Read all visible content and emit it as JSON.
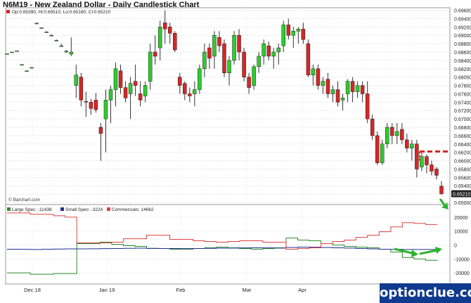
{
  "title": "N6M19 - New Zealand Dollar - Daily Candlestick Chart",
  "colors": {
    "up": "#2ecc2e",
    "down": "#d62626",
    "large_spec": "#2e8b2e",
    "small_spec": "#1f2f8f",
    "commercials": "#e04040",
    "arrow": "#2db32d",
    "level": "#d62626"
  },
  "ohlc_legend": "Op:0.65390, Hi:0.65510, Lo:0.65180, Cl:0.65210",
  "last_price": "0.65210",
  "source": "© Barchart.com",
  "watermark": "optionclue.com",
  "chart_data": [
    {
      "type": "candlestick",
      "title": "N6M19 - New Zealand Dollar - Daily Candlestick Chart",
      "x_ticks": [
        "Dec 18",
        "Jan 19",
        "Feb",
        "Mar",
        "Apr"
      ],
      "y_ticks": [
        "0.69600",
        "0.69400",
        "0.69200",
        "0.69000",
        "0.68800",
        "0.68600",
        "0.68400",
        "0.68200",
        "0.68000",
        "0.67800",
        "0.67600",
        "0.67400",
        "0.67200",
        "0.67000",
        "0.66800",
        "0.66600",
        "0.66400",
        "0.66200",
        "0.66000",
        "0.65800",
        "0.65600",
        "0.65400",
        "0.65200",
        "0.65000"
      ],
      "ylim": [
        0.6495,
        0.6966
      ],
      "grid": true,
      "annotations": {
        "resistance_level": 0.6622,
        "last_price": 0.6521
      },
      "candles": [
        [
          0.6855,
          0.6856,
          0.6855,
          0.6856
        ],
        [
          0.686,
          0.686,
          0.6859,
          0.686
        ],
        [
          0.6862,
          0.6863,
          0.6862,
          0.6863
        ],
        [
          0.683,
          0.6831,
          0.6829,
          0.683
        ],
        [
          0.6815,
          0.6816,
          0.6814,
          0.6815
        ],
        [
          0.6823,
          0.6824,
          0.6822,
          0.6823
        ],
        [
          0.6929,
          0.6931,
          0.6928,
          0.6929
        ],
        [
          0.6918,
          0.6919,
          0.6917,
          0.6918
        ],
        [
          0.6908,
          0.691,
          0.6907,
          0.6908
        ],
        [
          0.69,
          0.6903,
          0.6898,
          0.69
        ],
        [
          0.6888,
          0.689,
          0.6886,
          0.6888
        ],
        [
          0.6875,
          0.688,
          0.6872,
          0.6875
        ],
        [
          0.686,
          0.6865,
          0.6858,
          0.6862
        ],
        [
          0.6855,
          0.6895,
          0.685,
          0.686
        ],
        [
          0.678,
          0.683,
          0.675,
          0.6805
        ],
        [
          0.68,
          0.681,
          0.673,
          0.6745
        ],
        [
          0.6742,
          0.6765,
          0.6705,
          0.674
        ],
        [
          0.674,
          0.6748,
          0.671,
          0.6725
        ],
        [
          0.6745,
          0.6762,
          0.6715,
          0.6722
        ],
        [
          0.668,
          0.669,
          0.66,
          0.6665
        ],
        [
          0.67,
          0.677,
          0.662,
          0.6745
        ],
        [
          0.6745,
          0.678,
          0.669,
          0.677
        ],
        [
          0.677,
          0.6835,
          0.673,
          0.682
        ],
        [
          0.6815,
          0.683,
          0.676,
          0.6775
        ],
        [
          0.6775,
          0.679,
          0.674,
          0.675
        ],
        [
          0.676,
          0.68,
          0.67,
          0.6785
        ],
        [
          0.679,
          0.683,
          0.6755,
          0.678
        ],
        [
          0.676,
          0.679,
          0.673,
          0.6745
        ],
        [
          0.6755,
          0.679,
          0.674,
          0.678
        ],
        [
          0.679,
          0.688,
          0.677,
          0.686
        ],
        [
          0.686,
          0.69,
          0.683,
          0.685
        ],
        [
          0.687,
          0.6935,
          0.684,
          0.692
        ],
        [
          0.693,
          0.696,
          0.688,
          0.6915
        ],
        [
          0.692,
          0.693,
          0.688,
          0.6905
        ],
        [
          0.6905,
          0.691,
          0.686,
          0.6865
        ],
        [
          0.68,
          0.681,
          0.676,
          0.678
        ],
        [
          0.6785,
          0.679,
          0.6745,
          0.676
        ],
        [
          0.676,
          0.6775,
          0.674,
          0.6755
        ],
        [
          0.676,
          0.679,
          0.673,
          0.677
        ],
        [
          0.677,
          0.683,
          0.676,
          0.682
        ],
        [
          0.682,
          0.688,
          0.68,
          0.686
        ],
        [
          0.687,
          0.688,
          0.682,
          0.6845
        ],
        [
          0.685,
          0.691,
          0.682,
          0.69
        ],
        [
          0.6895,
          0.691,
          0.686,
          0.6875
        ],
        [
          0.688,
          0.689,
          0.68,
          0.681
        ],
        [
          0.681,
          0.685,
          0.678,
          0.684
        ],
        [
          0.684,
          0.691,
          0.683,
          0.69
        ],
        [
          0.69,
          0.6915,
          0.684,
          0.686
        ],
        [
          0.686,
          0.687,
          0.679,
          0.68
        ],
        [
          0.68,
          0.681,
          0.676,
          0.6775
        ],
        [
          0.678,
          0.683,
          0.677,
          0.6825
        ],
        [
          0.6825,
          0.686,
          0.681,
          0.685
        ],
        [
          0.685,
          0.689,
          0.683,
          0.688
        ],
        [
          0.6875,
          0.6885,
          0.684,
          0.685
        ],
        [
          0.685,
          0.687,
          0.682,
          0.686
        ],
        [
          0.686,
          0.688,
          0.683,
          0.687
        ],
        [
          0.6875,
          0.6935,
          0.686,
          0.6925
        ],
        [
          0.6925,
          0.694,
          0.689,
          0.69
        ],
        [
          0.69,
          0.692,
          0.687,
          0.691
        ],
        [
          0.691,
          0.692,
          0.688,
          0.6915
        ],
        [
          0.6915,
          0.693,
          0.688,
          0.689
        ],
        [
          0.688,
          0.689,
          0.68,
          0.6805
        ],
        [
          0.6805,
          0.683,
          0.678,
          0.682
        ],
        [
          0.682,
          0.683,
          0.677,
          0.678
        ],
        [
          0.678,
          0.68,
          0.676,
          0.679
        ],
        [
          0.6795,
          0.681,
          0.675,
          0.676
        ],
        [
          0.676,
          0.678,
          0.674,
          0.677
        ],
        [
          0.677,
          0.679,
          0.673,
          0.674
        ],
        [
          0.6745,
          0.676,
          0.672,
          0.675
        ],
        [
          0.676,
          0.6795,
          0.674,
          0.679
        ],
        [
          0.679,
          0.68,
          0.674,
          0.6765
        ],
        [
          0.6765,
          0.679,
          0.675,
          0.678
        ],
        [
          0.678,
          0.679,
          0.674,
          0.676
        ],
        [
          0.676,
          0.679,
          0.669,
          0.67
        ],
        [
          0.67,
          0.671,
          0.665,
          0.666
        ],
        [
          0.666,
          0.667,
          0.659,
          0.6595
        ],
        [
          0.6595,
          0.665,
          0.659,
          0.664
        ],
        [
          0.664,
          0.669,
          0.663,
          0.668
        ],
        [
          0.668,
          0.669,
          0.664,
          0.666
        ],
        [
          0.666,
          0.669,
          0.664,
          0.667
        ],
        [
          0.6675,
          0.669,
          0.664,
          0.665
        ],
        [
          0.665,
          0.6665,
          0.662,
          0.663
        ],
        [
          0.663,
          0.665,
          0.66,
          0.664
        ],
        [
          0.664,
          0.665,
          0.656,
          0.658
        ],
        [
          0.6585,
          0.662,
          0.6575,
          0.661
        ],
        [
          0.661,
          0.6615,
          0.657,
          0.659
        ],
        [
          0.659,
          0.66,
          0.6565,
          0.6575
        ],
        [
          0.658,
          0.6585,
          0.6555,
          0.6565
        ],
        [
          0.6539,
          0.6551,
          0.6518,
          0.6521
        ]
      ]
    },
    {
      "type": "line",
      "title": "COT",
      "y_ticks": [
        20000,
        10000,
        0,
        -10000,
        -20000
      ],
      "ylim": [
        -28000,
        29000
      ],
      "step": true,
      "series": [
        {
          "name": "Large Spec",
          "value": -11438,
          "values": [
            -20000,
            -20000,
            -21000,
            -21000,
            -20500,
            -20500,
            1000,
            1000,
            2000,
            500,
            -500,
            -1000,
            -2500,
            -2500,
            -3000,
            -3000,
            -2500,
            -2000,
            -1500,
            -2000,
            -2500,
            -3000,
            -2500,
            -2000,
            5000,
            3500,
            3000,
            1000,
            0,
            -1000,
            -1500,
            -2000,
            -3000,
            -5000,
            -9000,
            -10000,
            -11000,
            -11438
          ]
        },
        {
          "name": "Small Spec",
          "value": -3224,
          "values": [
            -3000,
            -3100,
            -3200,
            -3000,
            -2900,
            -2800,
            -2800,
            -2700,
            -2600,
            -2500,
            -2400,
            -2300,
            -2400,
            -2500,
            -2500,
            -2600,
            -2500,
            -2400,
            -2300,
            -2200,
            -2100,
            -2000,
            -2100,
            -2200,
            -1800,
            -1500,
            -1600,
            -1800,
            -2000,
            -2200,
            -2500,
            -2800,
            -3000,
            -3100,
            -3200,
            -3224,
            -3224,
            -3224
          ]
        },
        {
          "name": "Commercials",
          "value": 14662,
          "values": [
            23000,
            23000,
            22000,
            22000,
            21000,
            20000,
            1500,
            1500,
            1500,
            2000,
            4500,
            4500,
            7000,
            7000,
            4000,
            4000,
            3000,
            2500,
            2000,
            2500,
            3000,
            3000,
            2000,
            2000,
            -3000,
            -2500,
            -2000,
            1000,
            2500,
            3500,
            5500,
            7000,
            9500,
            13000,
            16000,
            15500,
            14662,
            14662
          ]
        }
      ]
    }
  ]
}
